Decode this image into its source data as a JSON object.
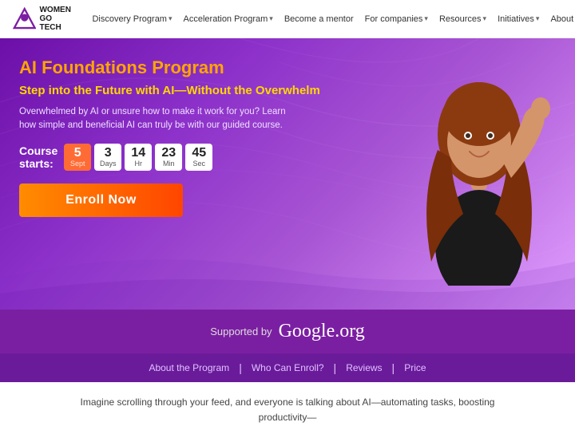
{
  "logo": {
    "text_line1": "WOMEN",
    "text_line2": "GO TECH"
  },
  "navbar": {
    "items": [
      {
        "label": "Discovery Program",
        "has_dropdown": true
      },
      {
        "label": "Acceleration Program",
        "has_dropdown": true
      },
      {
        "label": "Become a mentor",
        "has_dropdown": false
      },
      {
        "label": "For companies",
        "has_dropdown": true
      },
      {
        "label": "Resources",
        "has_dropdown": true
      },
      {
        "label": "Initiatives",
        "has_dropdown": true
      },
      {
        "label": "About",
        "has_dropdown": true
      }
    ]
  },
  "hero": {
    "title": "AI Foundations Program",
    "subtitle": "Step into the Future with AI—Without the Overwhelm",
    "description": "Overwhelmed by AI or unsure how to make it work for you? Learn how simple and beneficial AI can truly be with our guided course.",
    "course_starts_label": "Course starts:",
    "countdown": {
      "day_num": "5",
      "day_label": "Sept",
      "days_num": "3",
      "days_label": "Days",
      "hr_num": "14",
      "hr_label": "Hr",
      "min_num": "23",
      "min_label": "Min",
      "sec_num": "45",
      "sec_label": "Sec"
    },
    "enroll_button": "Enroll Now"
  },
  "support": {
    "label": "Supported by",
    "sponsor": "Google.org"
  },
  "sub_nav": {
    "items": [
      "About the Program",
      "Who Can Enroll?",
      "Reviews",
      "Price"
    ]
  },
  "bottom": {
    "text": "Imagine scrolling through your feed, and everyone is talking about AI—automating tasks, boosting productivity—"
  }
}
